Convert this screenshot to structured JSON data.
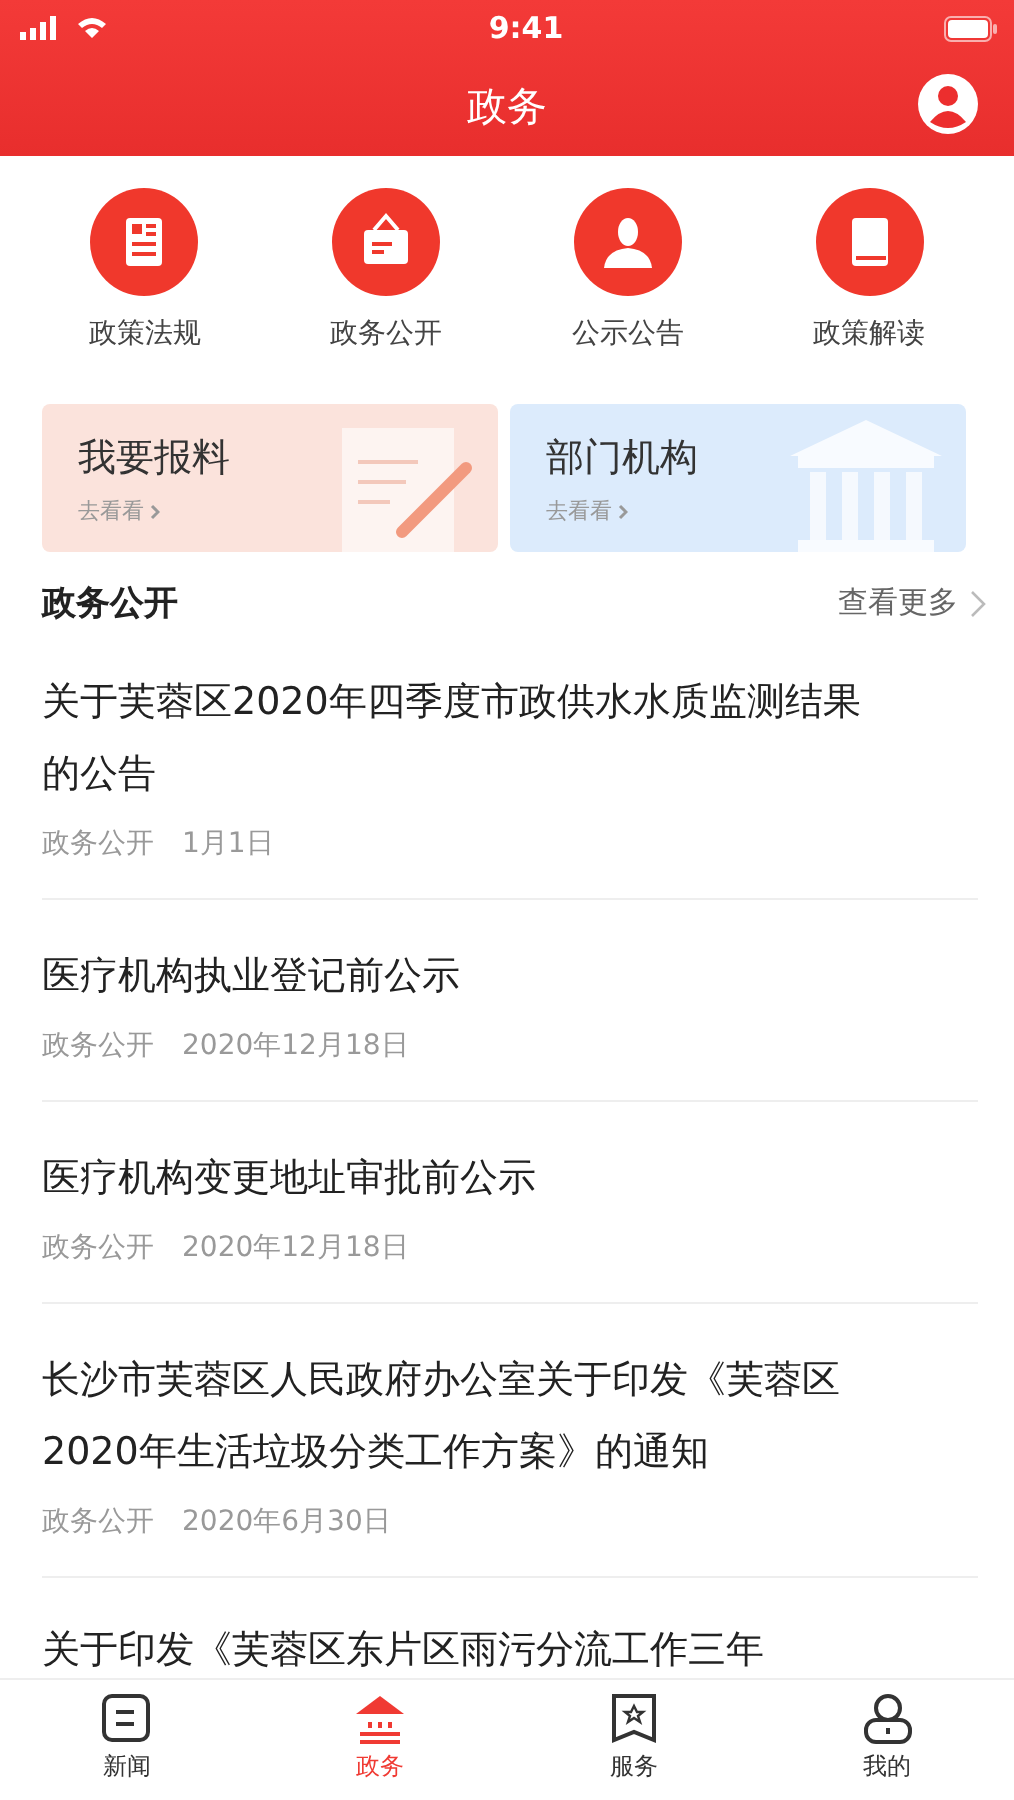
{
  "status_bar": {
    "time": "9:41"
  },
  "header": {
    "title": "政务"
  },
  "shortcuts": [
    {
      "label": "政策法规",
      "kind": "document"
    },
    {
      "label": "政务公开",
      "kind": "sign"
    },
    {
      "label": "公示公告",
      "kind": "person"
    },
    {
      "label": "政策解读",
      "kind": "book"
    }
  ],
  "cards": [
    {
      "title": "我要报料",
      "link": "去看看",
      "kind": "report"
    },
    {
      "title": "部门机构",
      "link": "去看看",
      "kind": "building"
    }
  ],
  "section": {
    "title": "政务公开",
    "more": "查看更多"
  },
  "articles": [
    {
      "title": "关于芙蓉区2020年四季度市政供水水质监测结果的公告",
      "category": "政务公开",
      "date": "1月1日"
    },
    {
      "title": "医疗机构执业登记前公示",
      "category": "政务公开",
      "date": "2020年12月18日"
    },
    {
      "title": "医疗机构变更地址审批前公示",
      "category": "政务公开",
      "date": "2020年12月18日"
    },
    {
      "title": "长沙市芙蓉区人民政府办公室关于印发《芙蓉区2020年生活垃圾分类工作方案》的通知",
      "category": "政务公开",
      "date": "2020年6月30日"
    },
    {
      "title": "关于印发《芙蓉区东片区雨污分流工作三年"
    }
  ],
  "tabbar": [
    {
      "label": "新闻",
      "kind": "news",
      "selected": false
    },
    {
      "label": "政务",
      "kind": "gov",
      "selected": true
    },
    {
      "label": "服务",
      "kind": "service",
      "selected": false
    },
    {
      "label": "我的",
      "kind": "me",
      "selected": false
    }
  ]
}
